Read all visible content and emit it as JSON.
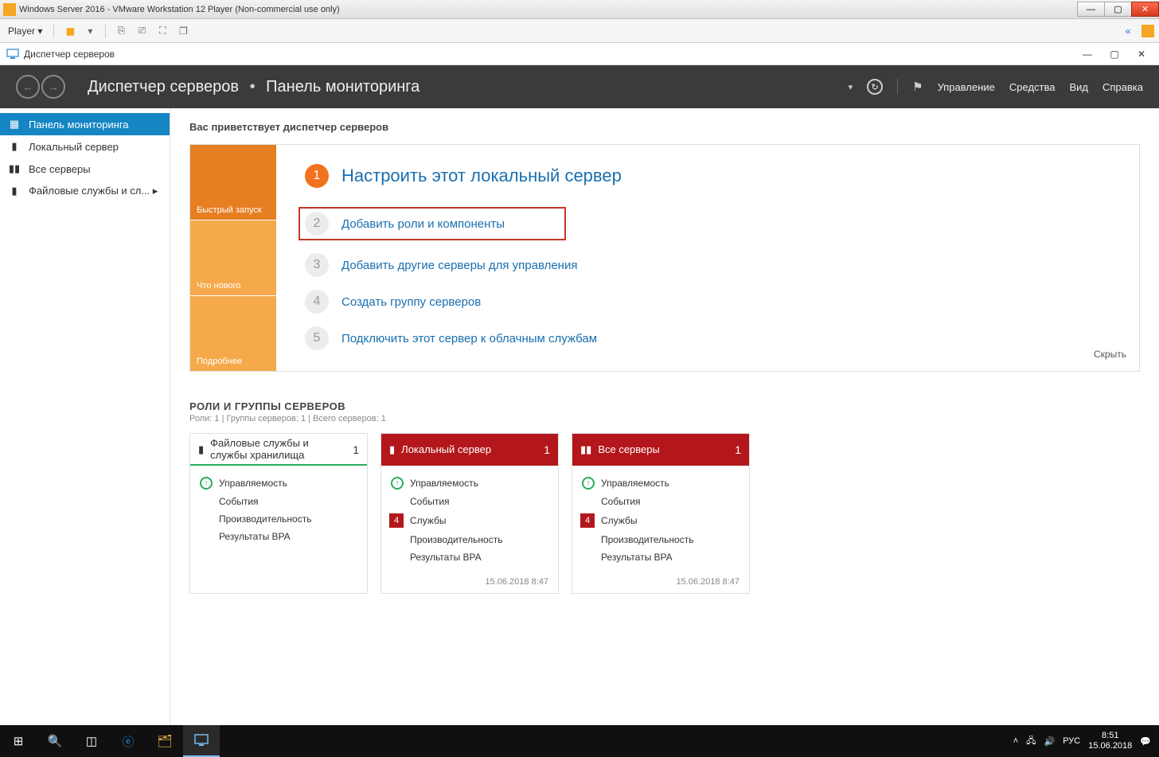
{
  "vmware": {
    "title": "Windows Server 2016 - VMware Workstation 12 Player (Non-commercial use only)",
    "player_menu": "Player ▾"
  },
  "inner_window": {
    "title": "Диспетчер серверов"
  },
  "header": {
    "breadcrumb_root": "Диспетчер серверов",
    "breadcrumb_current": "Панель мониторинга",
    "tools": {
      "manage": "Управление",
      "tools": "Средства",
      "view": "Вид",
      "help": "Справка"
    }
  },
  "sidebar": {
    "items": [
      {
        "icon": "▦",
        "label": "Панель мониторинга"
      },
      {
        "icon": "▮",
        "label": "Локальный сервер"
      },
      {
        "icon": "▮▮",
        "label": "Все серверы"
      },
      {
        "icon": "▮",
        "label": "Файловые службы и сл... ▸"
      }
    ]
  },
  "welcome": {
    "title": "Вас приветствует диспетчер серверов",
    "tiles": {
      "quickstart": "Быстрый запуск",
      "whatsnew": "Что нового",
      "more": "Подробнее"
    },
    "steps": [
      {
        "num": "1",
        "text": "Настроить этот локальный сервер"
      },
      {
        "num": "2",
        "text": "Добавить роли и компоненты"
      },
      {
        "num": "3",
        "text": "Добавить другие серверы для управления"
      },
      {
        "num": "4",
        "text": "Создать группу серверов"
      },
      {
        "num": "5",
        "text": "Подключить этот сервер к облачным службам"
      }
    ],
    "hide": "Скрыть"
  },
  "roles": {
    "title": "РОЛИ И ГРУППЫ СЕРВЕРОВ",
    "subtitle": "Роли: 1 | Группы серверов: 1 | Всего серверов: 1",
    "cards": [
      {
        "title": "Файловые службы и службы хранилища",
        "count": "1",
        "items": {
          "manageability": "Управляемость",
          "events": "События",
          "performance": "Производительность",
          "bpa": "Результаты BPA"
        }
      },
      {
        "title": "Локальный сервер",
        "count": "1",
        "badge": "4",
        "items": {
          "manageability": "Управляемость",
          "events": "События",
          "services": "Службы",
          "performance": "Производительность",
          "bpa": "Результаты BPA"
        },
        "timestamp": "15.06.2018 8:47"
      },
      {
        "title": "Все серверы",
        "count": "1",
        "badge": "4",
        "items": {
          "manageability": "Управляемость",
          "events": "События",
          "services": "Службы",
          "performance": "Производительность",
          "bpa": "Результаты BPA"
        },
        "timestamp": "15.06.2018 8:47"
      }
    ]
  },
  "taskbar": {
    "lang": "РУС",
    "time": "8:51",
    "date": "15.06.2018"
  }
}
